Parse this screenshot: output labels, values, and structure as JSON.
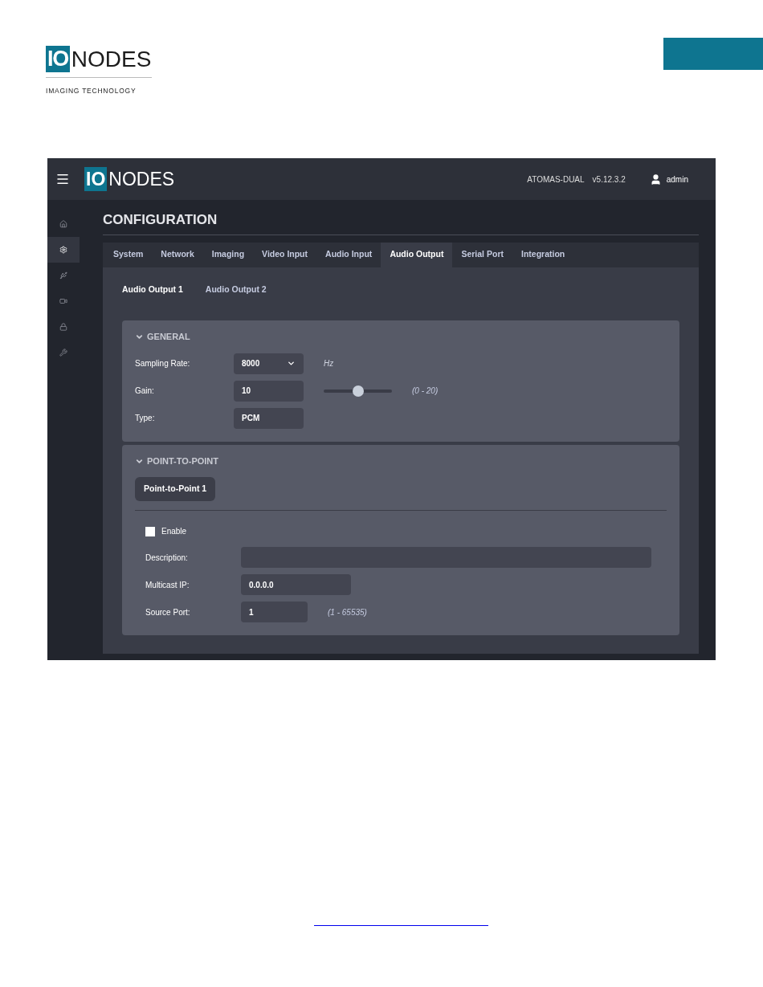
{
  "doc_logo": {
    "mark": "IO",
    "word": "NODES",
    "tagline": "IMAGING TECHNOLOGY"
  },
  "app": {
    "logo": {
      "mark": "IO",
      "word": "NODES"
    },
    "device": "ATOMAS-DUAL",
    "version": "v5.12.3.2",
    "user": "admin"
  },
  "sidebar": {
    "items": [
      {
        "kind": "home",
        "selected": false
      },
      {
        "kind": "settings",
        "selected": true
      },
      {
        "kind": "usb",
        "selected": false
      },
      {
        "kind": "camera",
        "selected": false
      },
      {
        "kind": "lock",
        "selected": false
      },
      {
        "kind": "wrench",
        "selected": false
      }
    ]
  },
  "title": "CONFIGURATION",
  "tabs": [
    {
      "label": "System",
      "selected": false
    },
    {
      "label": "Network",
      "selected": false
    },
    {
      "label": "Imaging",
      "selected": false
    },
    {
      "label": "Video Input",
      "selected": false
    },
    {
      "label": "Audio Input",
      "selected": false
    },
    {
      "label": "Audio Output",
      "selected": true
    },
    {
      "label": "Serial Port",
      "selected": false
    },
    {
      "label": "Integration",
      "selected": false
    }
  ],
  "subtabs": [
    {
      "label": "Audio Output 1",
      "selected": true
    },
    {
      "label": "Audio Output 2",
      "selected": false
    }
  ],
  "general": {
    "title": "GENERAL",
    "expanded": true,
    "fields": [
      {
        "kind": "select",
        "label": "Sampling Rate:",
        "value": "8000",
        "unit": "Hz"
      },
      {
        "kind": "slider",
        "label": "Gain:",
        "value": "10",
        "level": 0.5,
        "range": "(0 - 20)"
      },
      {
        "kind": "text",
        "label": "Type:",
        "value": "PCM"
      }
    ]
  },
  "point_to_point": {
    "title": "POINT-TO-POINT",
    "expanded": true,
    "tabs": [
      {
        "label": "Point-to-Point 1",
        "selected": true
      }
    ],
    "enable": {
      "label": "Enable",
      "checked": false
    },
    "fields": [
      {
        "kind": "wide",
        "label": "Description:"
      },
      {
        "kind": "medium",
        "label": "Multicast IP:",
        "value": "0.0.0.0"
      },
      {
        "kind": "small",
        "label": "Source Port:",
        "value": "1",
        "range": "(1 - 65535)"
      }
    ]
  }
}
